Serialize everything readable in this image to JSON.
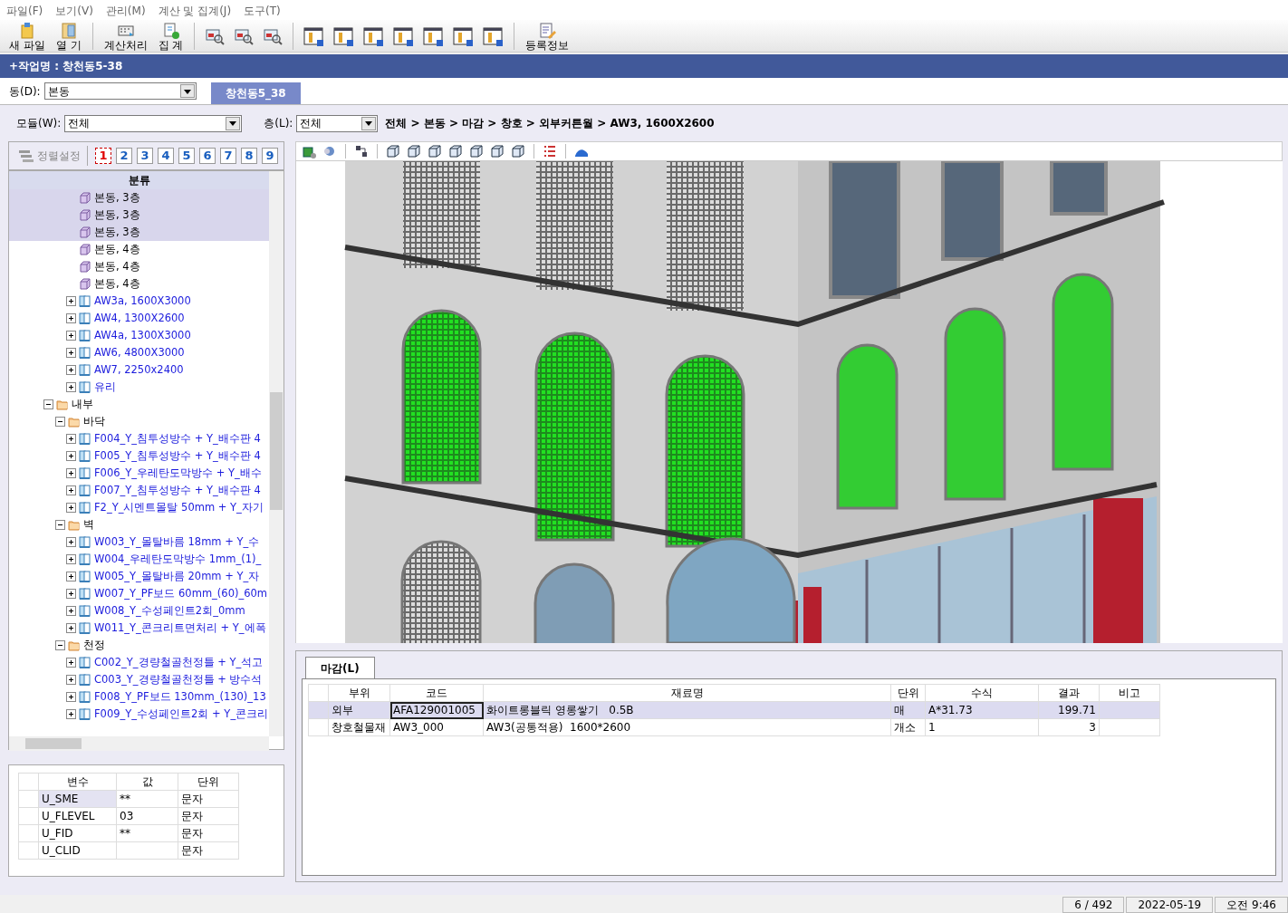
{
  "menu": [
    "파일(F)",
    "보기(V)",
    "관리(M)",
    "계산 및 집계(J)",
    "도구(T)"
  ],
  "toolbar": [
    {
      "label": "새 파일"
    },
    {
      "label": "열 기"
    },
    {
      "label": "계산처리"
    },
    {
      "label": "집 계"
    },
    {
      "label": "등록정보"
    }
  ],
  "job_title": "+작업명 : 창천동5-38",
  "building": {
    "label": "동(D):",
    "value": "본동"
  },
  "project_tabs": [
    {
      "label": "창천동5_38",
      "selected": true
    }
  ],
  "module": {
    "label": "모듈(W):",
    "value": "전체"
  },
  "floor": {
    "label": "층(L):",
    "value": "전체"
  },
  "breadcrumb": "전체 > 본동 > 마감 > 창호 > 외부커튼월 > AW3, 1600X2600",
  "sort_button": {
    "label": "정렬설정",
    "disabled": true
  },
  "level_buttons": [
    {
      "label": "1",
      "selected": true
    },
    {
      "label": "2",
      "selected": false
    },
    {
      "label": "3",
      "selected": false
    },
    {
      "label": "4",
      "selected": false
    },
    {
      "label": "5",
      "selected": false
    },
    {
      "label": "6",
      "selected": false
    },
    {
      "label": "7",
      "selected": false
    },
    {
      "label": "8",
      "selected": false
    },
    {
      "label": "9",
      "selected": false
    }
  ],
  "tree_header": "분류",
  "tree": [
    {
      "children": [
        {
          "children": [
            {
              "kind": "cube",
              "label": "본동, 3층",
              "selected": true
            },
            {
              "kind": "cube",
              "label": "본동, 3층",
              "selected": true
            },
            {
              "kind": "cube",
              "label": "본동, 3층",
              "selected": true
            },
            {
              "kind": "cube",
              "label": "본동, 4층",
              "selected": false
            },
            {
              "kind": "cube",
              "label": "본동, 4층",
              "selected": false
            },
            {
              "kind": "cube",
              "label": "본동, 4층",
              "selected": false
            },
            {
              "kind": "element",
              "label": "AW3a, 1600X3000",
              "expanded": false,
              "selected": false
            },
            {
              "kind": "element",
              "label": "AW4, 1300X2600",
              "expanded": false,
              "selected": false
            },
            {
              "kind": "element",
              "label": "AW4a, 1300X3000",
              "expanded": false,
              "selected": false
            },
            {
              "kind": "element",
              "label": "AW6, 4800X3000",
              "expanded": false,
              "selected": false
            },
            {
              "kind": "element",
              "label": "AW7, 2250x2400",
              "expanded": false,
              "selected": false
            },
            {
              "kind": "element",
              "label": "유리",
              "expanded": false,
              "selected": false
            }
          ]
        }
      ]
    },
    {
      "kind": "folder",
      "label": "내부",
      "expanded": true,
      "selected": false,
      "children": [
        {
          "kind": "folder",
          "label": "바닥",
          "expanded": true,
          "selected": false,
          "children": [
            {
              "kind": "element",
              "label": "F004_Y_침투성방수 + Y_배수판 4",
              "expanded": false,
              "selected": false
            },
            {
              "kind": "element",
              "label": "F005_Y_침투성방수 + Y_배수판 4",
              "expanded": false,
              "selected": false
            },
            {
              "kind": "element",
              "label": "F006_Y_우레탄도막방수 + Y_배수",
              "expanded": false,
              "selected": false
            },
            {
              "kind": "element",
              "label": "F007_Y_침투성방수 + Y_배수판 4",
              "expanded": false,
              "selected": false
            },
            {
              "kind": "element",
              "label": "F2_Y_시멘트몰탈 50mm + Y_자기",
              "expanded": false,
              "selected": false
            }
          ]
        },
        {
          "kind": "folder",
          "label": "벽",
          "expanded": true,
          "selected": false,
          "children": [
            {
              "kind": "element",
              "label": "W003_Y_몰탈바름 18mm + Y_수",
              "expanded": false,
              "selected": false
            },
            {
              "kind": "element",
              "label": "W004_우레탄도막방수 1mm_(1)_",
              "expanded": false,
              "selected": false
            },
            {
              "kind": "element",
              "label": "W005_Y_몰탈바름 20mm + Y_자",
              "expanded": false,
              "selected": false
            },
            {
              "kind": "element",
              "label": "W007_Y_PF보드 60mm_(60)_60m",
              "expanded": false,
              "selected": false
            },
            {
              "kind": "element",
              "label": "W008_Y_수성페인트2회_0mm",
              "expanded": false,
              "selected": false
            },
            {
              "kind": "element",
              "label": "W011_Y_콘크리트면처리 + Y_에폭",
              "expanded": false,
              "selected": false
            }
          ]
        },
        {
          "kind": "folder",
          "label": "천정",
          "expanded": true,
          "selected": false,
          "children": [
            {
              "kind": "element",
              "label": "C002_Y_경량철골천정틀 + Y_석고",
              "expanded": false,
              "selected": false
            },
            {
              "kind": "element",
              "label": "C003_Y_경량철골천정틀 + 방수석",
              "expanded": false,
              "selected": false
            },
            {
              "kind": "element",
              "label": "F008_Y_PF보드 130mm_(130)_13",
              "expanded": false,
              "selected": false
            },
            {
              "kind": "element",
              "label": "F009_Y_수성페인트2회 + Y_콘크리",
              "expanded": false,
              "selected": false
            }
          ]
        }
      ]
    }
  ],
  "variables": {
    "columns": [
      "변수",
      "값",
      "단위"
    ],
    "rows": [
      {
        "cells": [
          "U_SME",
          "**",
          "문자"
        ],
        "selected": true
      },
      {
        "cells": [
          "U_FLEVEL",
          "03",
          "문자"
        ],
        "selected": false
      },
      {
        "cells": [
          "U_FID",
          "**",
          "문자"
        ],
        "selected": false
      },
      {
        "cells": [
          "U_CLID",
          "",
          "문자"
        ],
        "selected": false
      }
    ]
  },
  "bottom_tabs": [
    {
      "label": "마감(L)",
      "selected": true
    }
  ],
  "table": {
    "columns": [
      "부위",
      "코드",
      "재료명",
      "단위",
      "수식",
      "결과",
      "비고"
    ],
    "rows": [
      {
        "cells": [
          "외부",
          "AFA129001005",
          "화이트롱블릭 영롱쌓기   0.5B",
          "매",
          "A*31.73",
          "199.71",
          ""
        ],
        "selected": true
      },
      {
        "cells": [
          "창호철물재",
          "AW3_000",
          "AW3(공통적용)  1600*2600",
          "개소",
          "1",
          "3",
          ""
        ],
        "selected": false
      }
    ]
  },
  "status_bar": [
    "6 / 492",
    "2022-05-19",
    "오전 9:46"
  ]
}
